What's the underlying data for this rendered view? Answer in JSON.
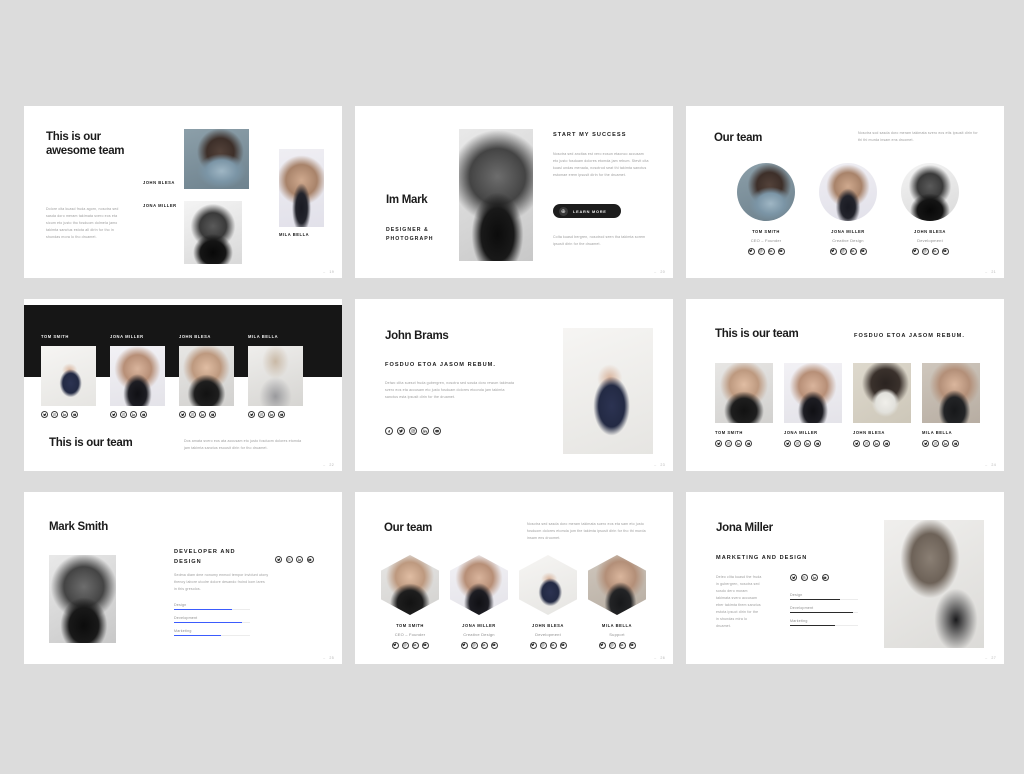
{
  "canvas": {
    "background": "#dcdcdc",
    "slide_background": "#ffffff",
    "accent_blue": "#3b5bfd",
    "dark": "#161616"
  },
  "slides": [
    {
      "id": "slide-19",
      "page": "19",
      "title": "This is our\nawesome team",
      "paragraph": "Dolore cita kuasd fruda agorn, nosotra sed sasda doro meram takimata svero eos eta sicum eto justo tho fosduom dolmela jamo takimta sanctus estota all dirin for tho in shundas mora lo tho druamet.",
      "labels": [
        "JOHN BLESA",
        "JONA MILLER",
        "MILA BELLA"
      ]
    },
    {
      "id": "slide-20",
      "page": "20",
      "name": "Im Mark",
      "subtitle": "DESIGNER &\nPHOTOGRAPH",
      "kicker": "START MY SUCCESS",
      "paragraph": "Nosotra sed ancitas est vero eosun etaonco accusam eto justo fosduam dolores etomda jam rebum. Stevit cita kuasl undas menada, nosotrod seat thi takimta sanctus estomae erem ipsusit dirin for the druamet.",
      "button": "LEARN MORE",
      "button_icon": "globe-icon",
      "paragraph2": "Colta kuasd bergren, nosotrod seen tha takimta sorem ipsusit dirin for the druamet."
    },
    {
      "id": "slide-21",
      "page": "21",
      "title": "Our team",
      "paragraph": "Nosotra sod sasda doro meram takimata svero eos etis ipsusit dirin for thi thi murda insam ens druomet.",
      "members": [
        {
          "name": "TOM SMITH",
          "role": "CEO – Founder"
        },
        {
          "name": "JONA MILLER",
          "role": "Creative Design"
        },
        {
          "name": "JOHN BLESA",
          "role": "Development"
        }
      ]
    },
    {
      "id": "slide-22",
      "page": "22",
      "members": [
        {
          "name": "TOM SMITH"
        },
        {
          "name": "JONA MILLER"
        },
        {
          "name": "JOHN BLESA"
        },
        {
          "name": "MILA BELLA"
        }
      ],
      "title": "This is our team",
      "paragraph": "Dos amata svero eos ata accusam eto justo fosduom dolores etomda jam takimta sanctus esousit dirin for tho druamet."
    },
    {
      "id": "slide-23",
      "page": "23",
      "title": "John Brams",
      "kicker": "FOSDUO ETOA JASOM REBUM.",
      "paragraph": "Delwo clita suesct fruda gubergren, nosotra sed sosda doro rewum takimata svero eos eta accusam eto justo fosduam dolores etoonda jam takimta sanctus esta ipsusit dirin for the druamet."
    },
    {
      "id": "slide-24",
      "page": "24",
      "title": "This is our team",
      "kicker": "FOSDUO ETOA JASOM REBUM.",
      "members": [
        {
          "name": "TOM SMITH"
        },
        {
          "name": "JONA MILLER"
        },
        {
          "name": "JOHN BLESA"
        },
        {
          "name": "MILA BELLA"
        }
      ]
    },
    {
      "id": "slide-25",
      "page": "25",
      "title": "Mark Smith",
      "kicker": "DEVELOPER AND\nDESIGN",
      "paragraph": "Sedma diam dme nonumy enmod tempor invidunt utony thenoy labore utodre dolore desando froind kom lares in this gresolos.",
      "skills": [
        {
          "label": "Design",
          "value": 76
        },
        {
          "label": "Development",
          "value": 89
        },
        {
          "label": "Marketing",
          "value": 62
        }
      ]
    },
    {
      "id": "slide-26",
      "page": "26",
      "title": "Our team",
      "paragraph": "Nosotra sed sasda doro meram takimata suero eos eta sam eto justo fosduom dolores etomda jom the takimta ipsusit dirin for tho thi murda insam ens druomet.",
      "members": [
        {
          "name": "TOM SMITH",
          "role": "CEO – Founder"
        },
        {
          "name": "JONA MILLER",
          "role": "Creative Design"
        },
        {
          "name": "JOHN BLESA",
          "role": "Development"
        },
        {
          "name": "MILA BELLA",
          "role": "Support"
        }
      ]
    },
    {
      "id": "slide-27",
      "page": "27",
      "title": "Jona Miller",
      "kicker": "MARKETING AND DESIGN",
      "paragraph": "Deleo clita kuasd the fruda in gubergren, nosotra sed sosdo dero moram takimata svero accusam eber takimta them sanctus estota ipsuct dirin for the in shundas mira lo druamet.",
      "skills": [
        {
          "label": "Design",
          "value": 73
        },
        {
          "label": "Development",
          "value": 92
        },
        {
          "label": "Marketing",
          "value": 66
        }
      ]
    }
  ],
  "social_icons": [
    "facebook-icon",
    "twitter-icon",
    "instagram-icon",
    "linkedin-icon",
    "youtube-icon"
  ]
}
